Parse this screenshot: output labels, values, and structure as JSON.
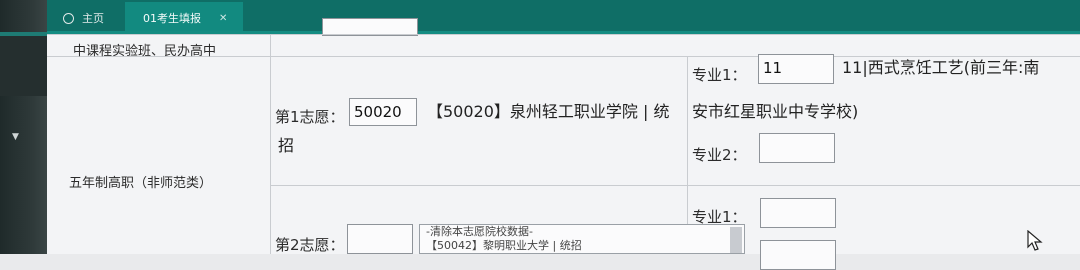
{
  "tabs": [
    {
      "label": "主页"
    },
    {
      "label": "01考生填报"
    }
  ],
  "rows": {
    "row1_label": "中课程实验班、民办高中",
    "row2_label": "五年制高职（非师范类）"
  },
  "choice1": {
    "label": "第1志愿：",
    "code": "50020",
    "school_line1": "【50020】泉州轻工职业学院 | 统",
    "school_line2": "招",
    "major1_label": "专业1：",
    "major1_value": "11",
    "major1_desc_line1": "11|西式烹饪工艺(前三年:南",
    "major1_desc_line2": "安市红星职业中专学校)",
    "major2_label": "专业2：",
    "major2_value": ""
  },
  "choice2": {
    "label": "第2志愿：",
    "code": "",
    "dropdown_options": [
      "-清除本志愿院校数据-",
      "【50042】黎明职业大学 | 统招"
    ],
    "major1_label": "专业1：",
    "major1_value": "",
    "major2_value": ""
  },
  "colors": {
    "tabbar": "#0f6e66",
    "active_tab": "#128a80",
    "sidebar": "#2f3a3a",
    "content_bg": "#f3f4f6"
  }
}
